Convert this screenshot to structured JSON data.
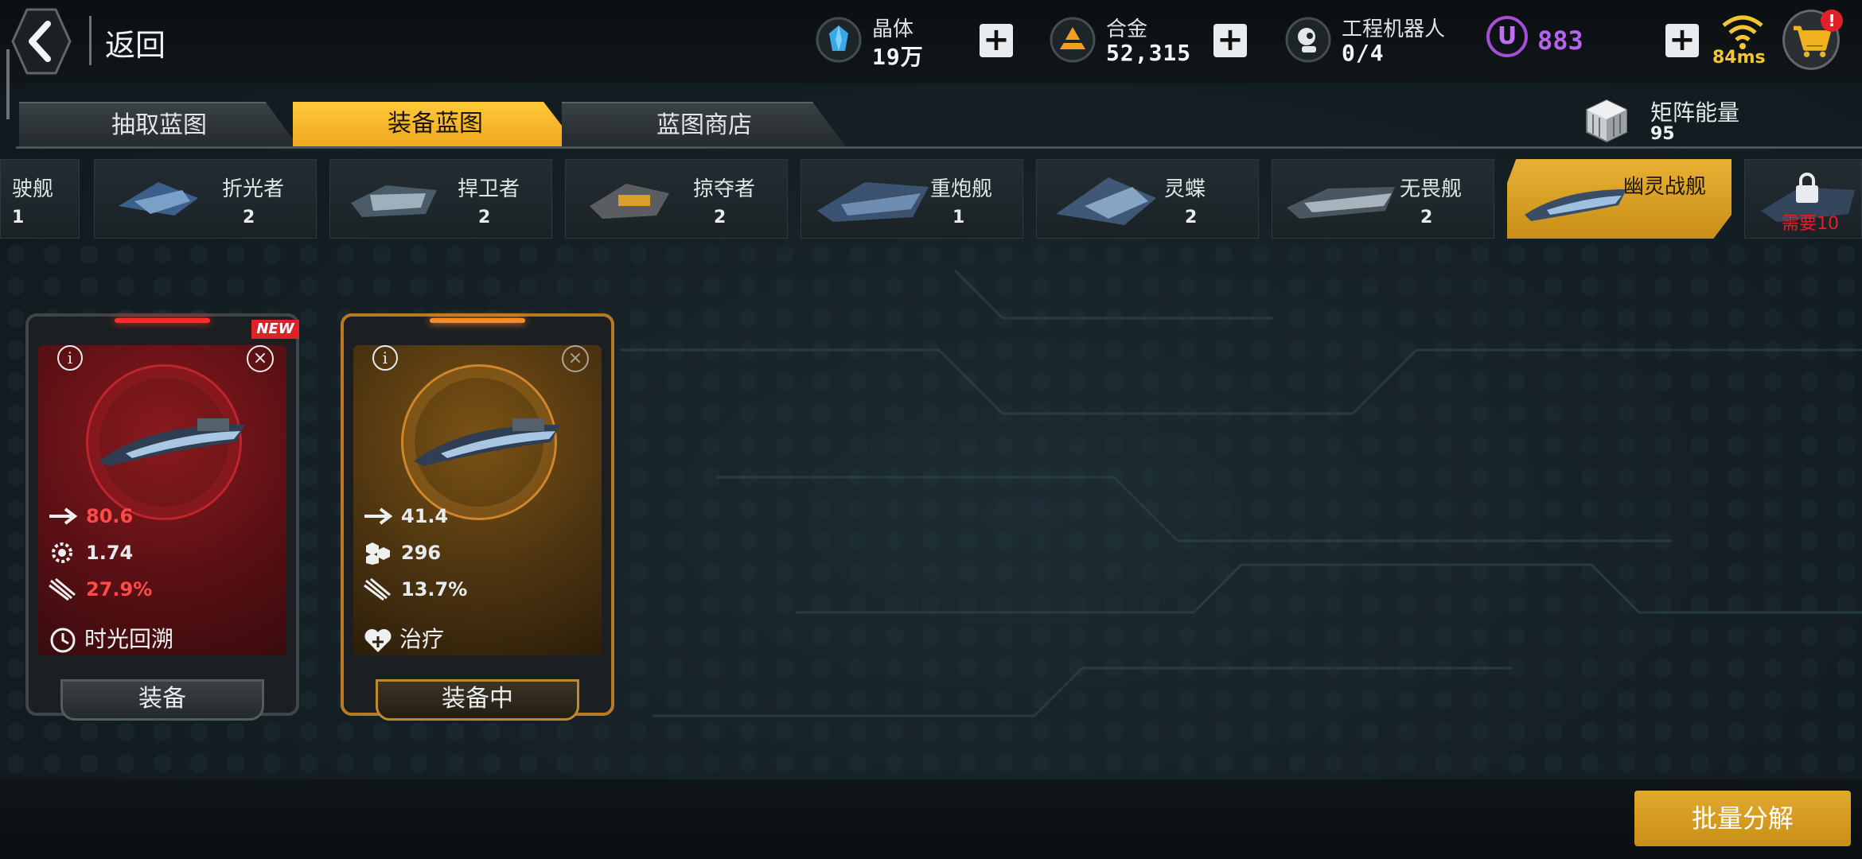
{
  "header": {
    "back_label": "返回",
    "resources": [
      {
        "label": "晶体",
        "value": "19万",
        "icon": "crystal-icon",
        "color": "#3aa8e6"
      },
      {
        "label": "合金",
        "value": "52,315",
        "icon": "alloy-icon",
        "color": "#f0a020"
      },
      {
        "label": "工程机器人",
        "value": "0/4",
        "icon": "robot-icon"
      }
    ],
    "u_currency": {
      "symbol": "U",
      "value": "883",
      "color": "#b764ec"
    },
    "ping": "84ms",
    "cart_badge": "!"
  },
  "tabs": [
    {
      "label": "抽取蓝图",
      "active": false
    },
    {
      "label": "装备蓝图",
      "active": true
    },
    {
      "label": "蓝图商店",
      "active": false
    }
  ],
  "matrix": {
    "label": "矩阵能量",
    "value": "95"
  },
  "ships": [
    {
      "name": "驶舰",
      "count": "1"
    },
    {
      "name": "折光者",
      "count": "2"
    },
    {
      "name": "捍卫者",
      "count": "2"
    },
    {
      "name": "掠夺者",
      "count": "2"
    },
    {
      "name": "重炮舰",
      "count": "1"
    },
    {
      "name": "灵蝶",
      "count": "2"
    },
    {
      "name": "无畏舰",
      "count": "2"
    },
    {
      "name": "幽灵战舰",
      "count": "",
      "selected": true
    },
    {
      "name": "",
      "locked": true,
      "requirement": "需要10"
    }
  ],
  "cards": [
    {
      "badge": "NEW",
      "rarity_color": "#c21c22",
      "stats": [
        {
          "icon": "damage-arrow-icon",
          "value": "80.6",
          "color": "#ff4a4a"
        },
        {
          "icon": "rate-gear-icon",
          "value": "1.74",
          "color": "#e9ecee"
        },
        {
          "icon": "crit-missile-icon",
          "value": "27.9%",
          "color": "#ff4a4a"
        }
      ],
      "skill": "时光回溯",
      "button": "装备"
    },
    {
      "badge": "",
      "rarity_color": "#e58a1c",
      "stats": [
        {
          "icon": "damage-arrow-icon",
          "value": "41.4",
          "color": "#e9ecee"
        },
        {
          "icon": "shield-hex-icon",
          "value": "296",
          "color": "#e9ecee"
        },
        {
          "icon": "crit-missile-icon",
          "value": "13.7%",
          "color": "#e9ecee"
        }
      ],
      "skill": "治疗",
      "button": "装备中"
    }
  ],
  "batch_button": "批量分解"
}
